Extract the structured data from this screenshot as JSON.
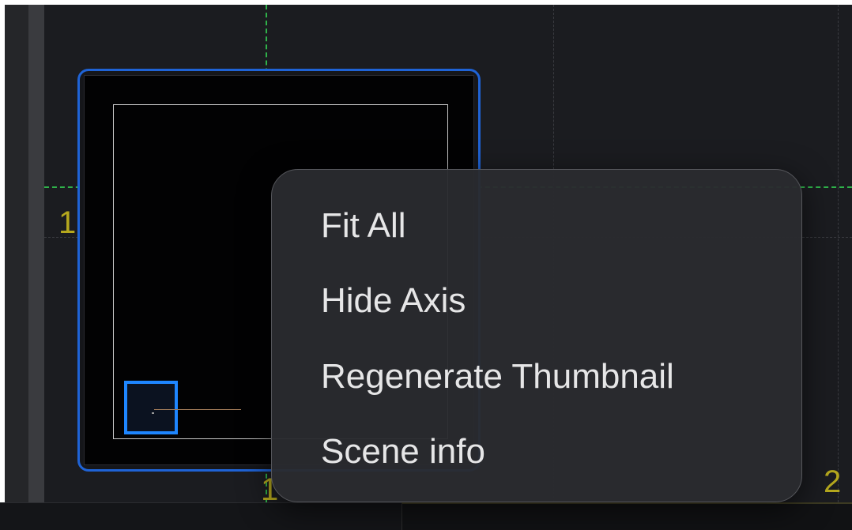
{
  "axes": {
    "y_label": "1",
    "x_label_bottom": "1",
    "x_label_right": "2"
  },
  "context_menu": {
    "items": [
      {
        "id": "fit-all",
        "label": "Fit All"
      },
      {
        "id": "hide-axis",
        "label": "Hide Axis"
      },
      {
        "id": "regenerate-thumbnail",
        "label": "Regenerate Thumbnail"
      },
      {
        "id": "scene-info",
        "label": "Scene info"
      }
    ]
  },
  "colors": {
    "axis_dash": "#2fb24a",
    "axis_label": "#b5a81e",
    "selection_border": "#1f63d6",
    "selected_item": "#1e86ff",
    "menu_background": "#2a2b2f",
    "menu_text": "#e6e6e7"
  }
}
